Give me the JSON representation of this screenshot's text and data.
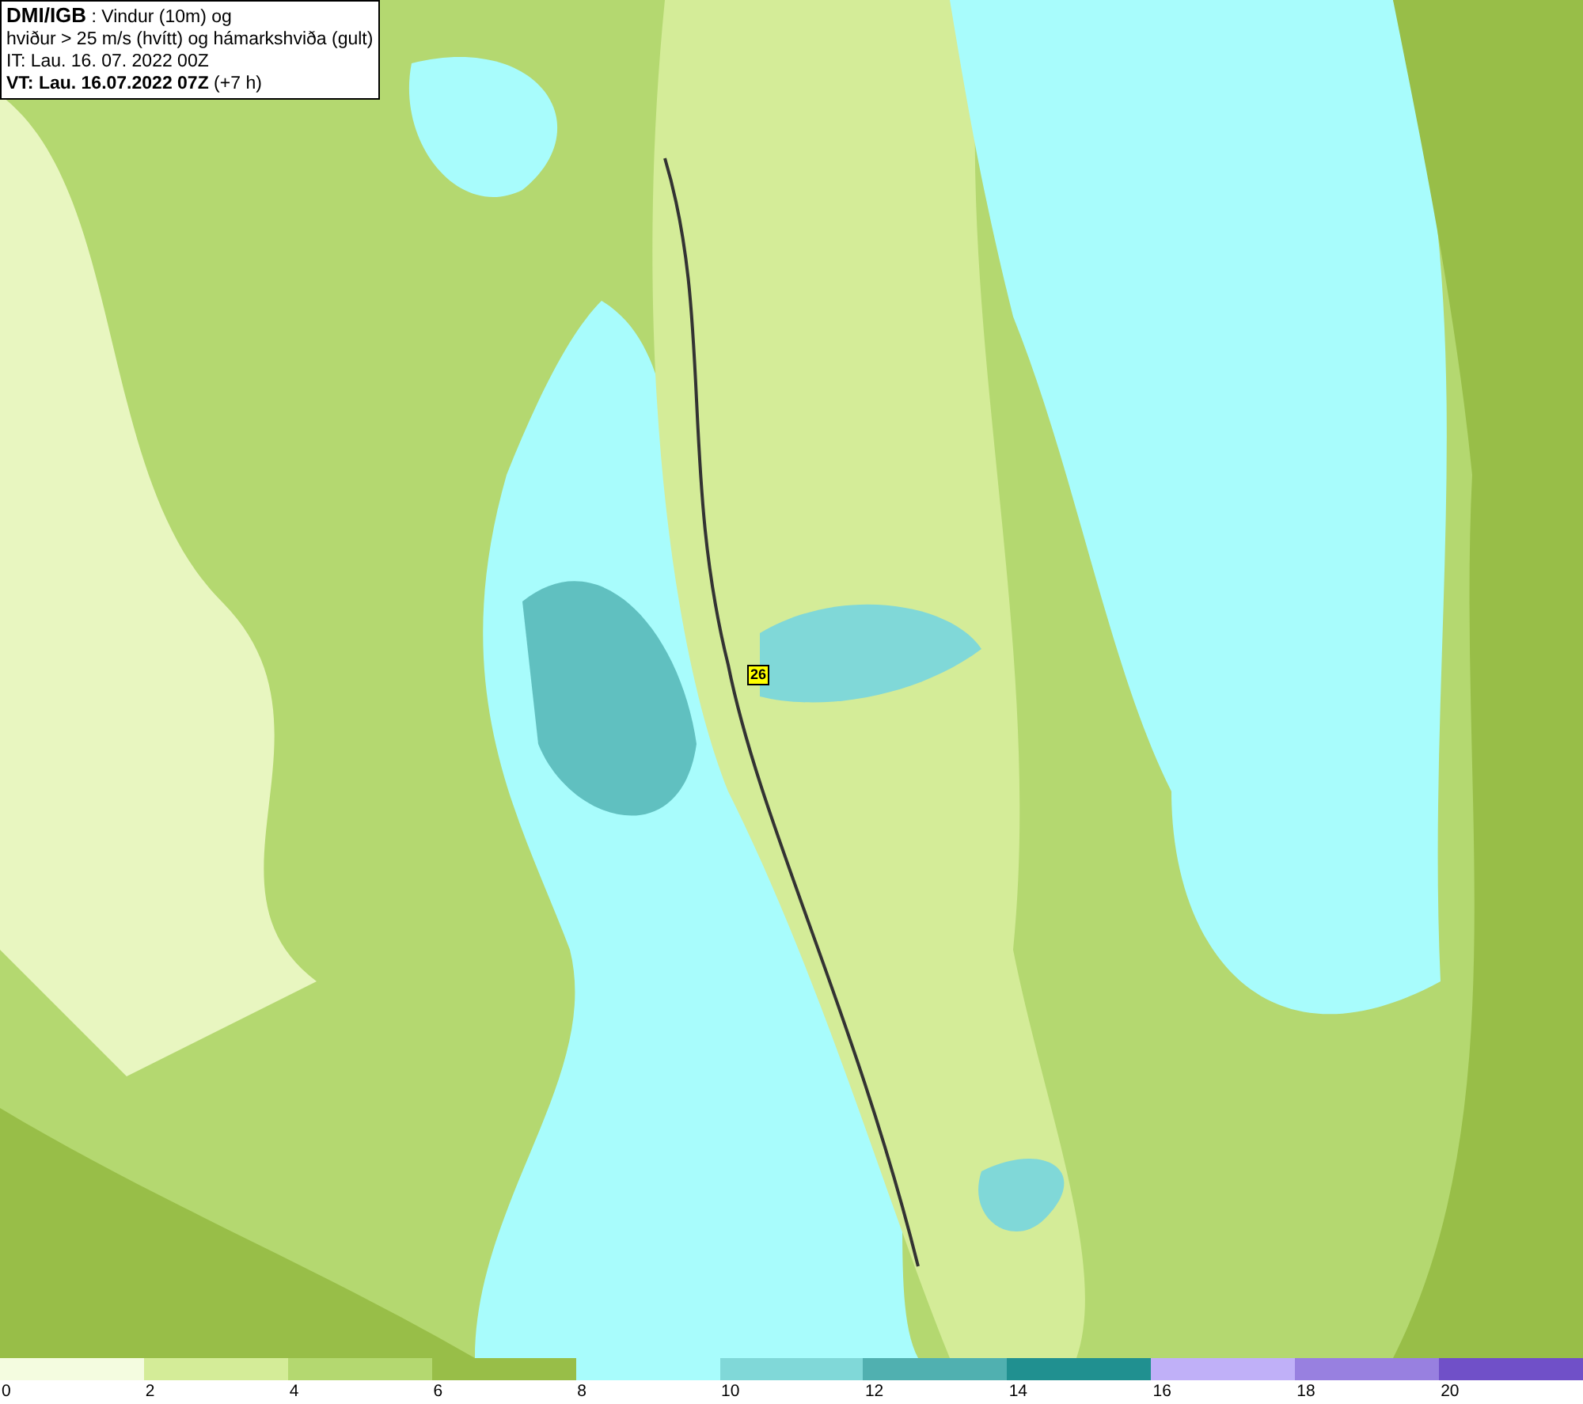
{
  "title_box": {
    "source": "DMI/IGB",
    "line_1": " : Vindur (10m) og",
    "line_2": "hviður > 25 m/s (hvítt) og hámarkshviða (gult)",
    "issue_time": "IT: Lau. 16. 07. 2022 00Z",
    "valid_time": "VT: Lau. 16.07.2022 07Z",
    "lead_time": " (+7 h)"
  },
  "map": {
    "gust_label": "26"
  },
  "legend": [
    {
      "label": "0",
      "color": "#f4fce0"
    },
    {
      "label": "2",
      "color": "#d4ec98"
    },
    {
      "label": "4",
      "color": "#b4d870"
    },
    {
      "label": "6",
      "color": "#98be48"
    },
    {
      "label": "8",
      "color": "#a8fcfc"
    },
    {
      "label": "10",
      "color": "#80d8d8"
    },
    {
      "label": "12",
      "color": "#50b0b0"
    },
    {
      "label": "14",
      "color": "#209090"
    },
    {
      "label": "16",
      "color": "#c0b0f8"
    },
    {
      "label": "18",
      "color": "#9880e0"
    },
    {
      "label": "20",
      "color": "#7050c8"
    }
  ]
}
